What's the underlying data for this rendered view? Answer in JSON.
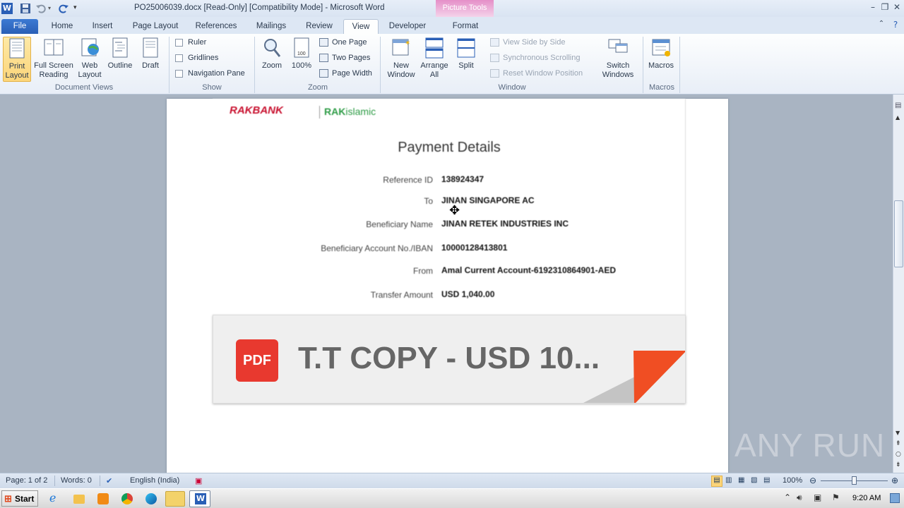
{
  "window": {
    "title": "PO25006039.docx [Read-Only] [Compatibility Mode] - Microsoft Word",
    "picture_tools": "Picture Tools"
  },
  "tabs": [
    "File",
    "Home",
    "Insert",
    "Page Layout",
    "References",
    "Mailings",
    "Review",
    "View",
    "Developer",
    "Format"
  ],
  "ribbon": {
    "document_views": {
      "label": "Document Views",
      "print_layout": "Print\nLayout",
      "full_screen_reading": "Full Screen\nReading",
      "web_layout": "Web\nLayout",
      "outline": "Outline",
      "draft": "Draft"
    },
    "show": {
      "label": "Show",
      "ruler": "Ruler",
      "gridlines": "Gridlines",
      "navigation_pane": "Navigation Pane"
    },
    "zoom": {
      "label": "Zoom",
      "zoom": "Zoom",
      "hundred": "100%",
      "one_page": "One Page",
      "two_pages": "Two Pages",
      "page_width": "Page Width"
    },
    "window": {
      "label": "Window",
      "new_window": "New\nWindow",
      "arrange_all": "Arrange\nAll",
      "split": "Split",
      "view_side_by_side": "View Side by Side",
      "synchronous_scrolling": "Synchronous Scrolling",
      "reset_window_position": "Reset Window Position",
      "switch_windows": "Switch\nWindows"
    },
    "macros": {
      "label": "Macros",
      "macros": "Macros"
    }
  },
  "document": {
    "bank_logo_left": "RAKBANK",
    "bank_logo_right_a": "RAK",
    "bank_logo_right_b": "islamic",
    "heading": "Payment Details",
    "fields": [
      {
        "label": "Reference ID",
        "value": "138924347"
      },
      {
        "label": "To",
        "value": "JINAN SINGAPORE AC"
      },
      {
        "label": "Beneficiary Name",
        "value": "JINAN RETEK INDUSTRIES INC"
      },
      {
        "label": "Beneficiary Account No./IBAN",
        "value": "10000128413801"
      },
      {
        "label": "From",
        "value": "Amal Current Account-6192310864901-AED"
      },
      {
        "label": "Transfer Amount",
        "value": "USD 1,040.00"
      }
    ],
    "pdf_badge": "PDF",
    "pdf_title": "T.T COPY - USD 10..."
  },
  "status": {
    "page": "Page: 1 of 2",
    "words": "Words: 0",
    "language": "English (India)",
    "zoom": "100%"
  },
  "taskbar": {
    "start": "Start",
    "time": "9:20 AM"
  },
  "watermark": "ANY RUN"
}
